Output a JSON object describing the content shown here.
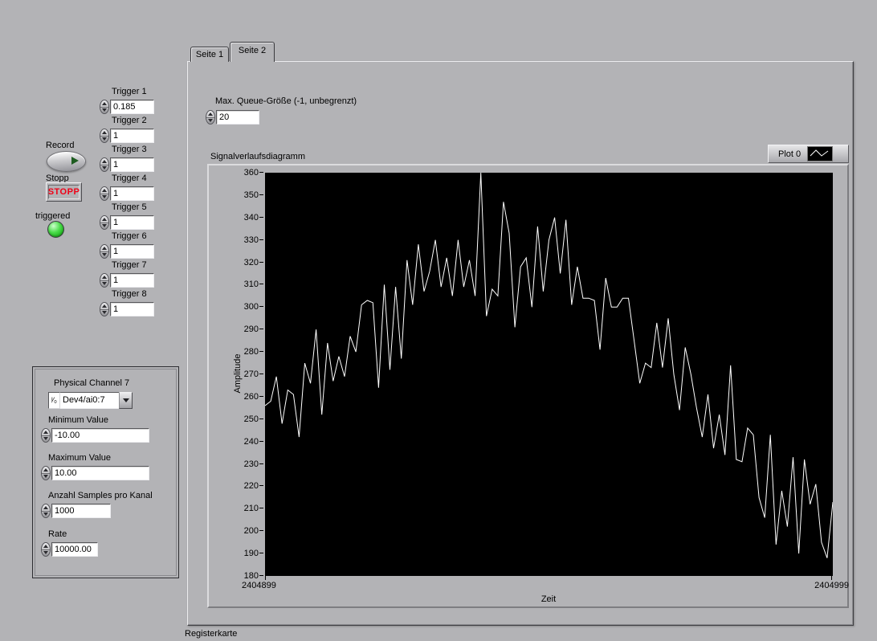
{
  "window": {
    "bg_color": "#b3b3b6",
    "bottom_label": "Registerkarte"
  },
  "left_panel": {
    "record_label": "Record",
    "stopp_label": "Stopp",
    "stopp_button_text": "STOPP",
    "triggered_label": "triggered",
    "led_color": "#35d435",
    "triggers": [
      {
        "label": "Trigger 1",
        "value": "0.185"
      },
      {
        "label": "Trigger 2",
        "value": "1"
      },
      {
        "label": "Trigger 3",
        "value": "1"
      },
      {
        "label": "Trigger 4",
        "value": "1"
      },
      {
        "label": "Trigger 5",
        "value": "1"
      },
      {
        "label": "Trigger 6",
        "value": "1"
      },
      {
        "label": "Trigger 7",
        "value": "1"
      },
      {
        "label": "Trigger 8",
        "value": "1"
      }
    ]
  },
  "daq_panel": {
    "physical_channel_label": "Physical Channel 7",
    "physical_channel_value": "Dev4/ai0:7",
    "io_glyph": "ᴵ⁄₀",
    "minimum_label": "Minimum Value",
    "minimum_value": "-10.00",
    "maximum_label": "Maximum Value",
    "maximum_value": "10.00",
    "samples_label": "Anzahl Samples pro Kanal",
    "samples_value": "1000",
    "rate_label": "Rate",
    "rate_value": "10000.00"
  },
  "tab_control": {
    "tabs": [
      {
        "label": "Seite 1"
      },
      {
        "label": "Seite 2"
      }
    ],
    "active_tab": "Seite 2",
    "queue_label": "Max. Queue-Größe (-1, unbegrenzt)",
    "queue_value": "20"
  },
  "chart_data": {
    "type": "line",
    "title": "Signalverlaufsdiagramm",
    "xlabel": "Zeit",
    "ylabel": "Amplitude",
    "legend": [
      {
        "name": "Plot 0",
        "color": "#ffffff"
      }
    ],
    "legend_position": "top-right",
    "grid": false,
    "bg_color": "#000000",
    "line_color": "#ffffff",
    "xlim": [
      2404899,
      2404999
    ],
    "ylim": [
      180,
      360
    ],
    "x_ticks": [
      "2404899",
      "2404999"
    ],
    "y_ticks": [
      360,
      350,
      340,
      330,
      320,
      310,
      300,
      290,
      280,
      270,
      260,
      250,
      240,
      230,
      220,
      210,
      200,
      190,
      180
    ],
    "x_start": 2404899,
    "x_step": 1,
    "values": [
      256,
      258,
      269,
      248,
      263,
      261,
      242,
      275,
      266,
      290,
      252,
      284,
      267,
      278,
      269,
      287,
      280,
      301,
      303,
      302,
      264,
      310,
      272,
      309,
      277,
      321,
      301,
      328,
      307,
      316,
      330,
      309,
      322,
      305,
      330,
      309,
      321,
      305,
      360,
      296,
      308,
      305,
      347,
      333,
      291,
      318,
      322,
      300,
      336,
      307,
      330,
      340,
      315,
      339,
      301,
      318,
      304,
      304,
      303,
      281,
      313,
      300,
      300,
      304,
      304,
      285,
      266,
      275,
      273,
      293,
      273,
      295,
      270,
      254,
      282,
      270,
      255,
      242,
      261,
      237,
      252,
      234,
      274,
      232,
      231,
      246,
      243,
      215,
      206,
      243,
      194,
      218,
      202,
      233,
      190,
      232,
      212,
      221,
      195,
      188,
      213
    ]
  }
}
